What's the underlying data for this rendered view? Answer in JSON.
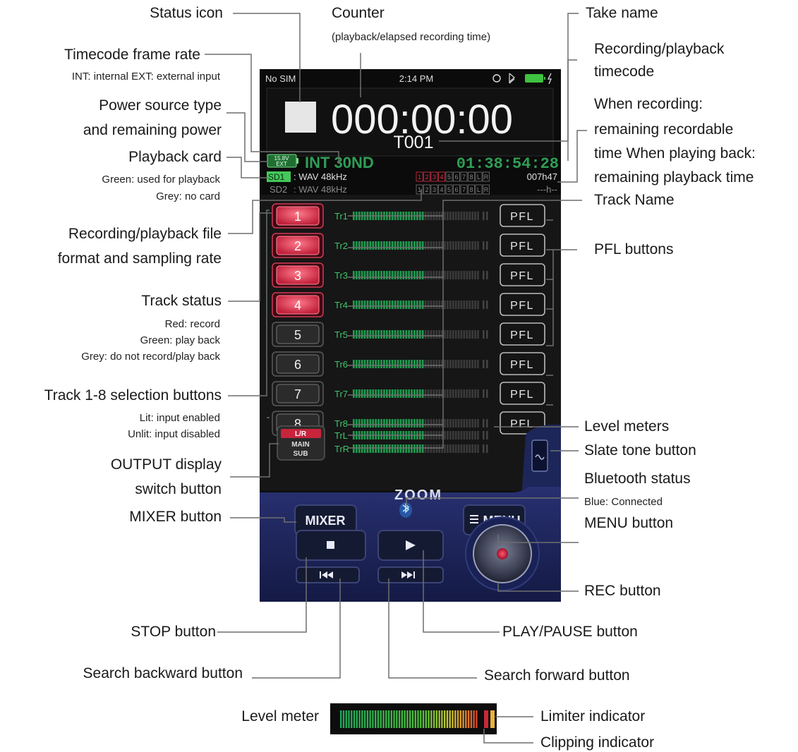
{
  "annotations": {
    "status_icon": "Status icon",
    "counter": "Counter",
    "counter_sub": "(playback/elapsed recording time)",
    "take_name": "Take name",
    "timecode_frame_rate": "Timecode frame rate",
    "timecode_frame_rate_sub": "INT: internal EXT: external input",
    "rec_play_timecode_1": "Recording/playback",
    "rec_play_timecode_2": "timecode",
    "power_source_1": "Power source type",
    "power_source_2": "and remaining power",
    "remaining_1": "When recording:",
    "remaining_2": "remaining recordable",
    "remaining_3": "time When playing back:",
    "remaining_4": "remaining playback time",
    "playback_card": "Playback card",
    "playback_card_green": "Green: used for playback",
    "playback_card_grey": "Grey: no card",
    "track_name": "Track Name",
    "file_format_1": "Recording/playback file",
    "file_format_2": "format and sampling rate",
    "pfl_buttons": "PFL buttons",
    "track_status": "Track status",
    "track_status_red": "Red: record",
    "track_status_green": "Green: play back",
    "track_status_grey": "Grey: do not record/play back",
    "track_selection": "Track 1-8 selection buttons",
    "track_selection_lit": "Lit: input enabled",
    "track_selection_unlit": "Unlit: input disabled",
    "level_meters": "Level meters",
    "slate_tone": "Slate tone button",
    "output_display_1": "OUTPUT display",
    "output_display_2": "switch button",
    "bluetooth_status": "Bluetooth status",
    "bluetooth_sub": "Blue: Connected",
    "mixer_button": "MIXER button",
    "menu_button": "MENU button",
    "rec_button": "REC button",
    "stop_button": "STOP button",
    "play_pause_button": "PLAY/PAUSE button",
    "search_backward": "Search backward button",
    "search_forward": "Search forward button",
    "level_meter": "Level meter",
    "limiter_indicator": "Limiter indicator",
    "clipping_indicator": "Clipping indicator"
  },
  "screen": {
    "status_bar": {
      "carrier": "No SIM",
      "time": "2:14 PM"
    },
    "counter": "000:00:00",
    "take_name": "T001",
    "power_badge_top": "15.8V",
    "power_badge_bottom": "EXT",
    "frame_rate": "INT 30ND",
    "timecode": "01:38:54:28",
    "cards": [
      {
        "label": "SD1",
        "format": ": WAV 48kHz",
        "remaining": "007h47",
        "active": true
      },
      {
        "label": "SD2",
        "format": ": WAV 48kHz",
        "remaining": "---h--",
        "active": false
      }
    ],
    "track_indicator_labels": [
      "1",
      "2",
      "3",
      "4",
      "5",
      "6",
      "7",
      "8",
      "L",
      "R"
    ],
    "tracks": [
      {
        "number": "1",
        "name": "Tr1",
        "armed": true
      },
      {
        "number": "2",
        "name": "Tr2",
        "armed": true
      },
      {
        "number": "3",
        "name": "Tr3",
        "armed": true
      },
      {
        "number": "4",
        "name": "Tr4",
        "armed": true
      },
      {
        "number": "5",
        "name": "Tr5",
        "armed": false
      },
      {
        "number": "6",
        "name": "Tr6",
        "armed": false
      },
      {
        "number": "7",
        "name": "Tr7",
        "armed": false
      },
      {
        "number": "8",
        "name": "Tr8",
        "armed": false
      }
    ],
    "pfl_label": "PFL",
    "output_lines": [
      "L/R",
      "MAIN",
      "SUB"
    ],
    "main_meters": [
      "TrL",
      "TrR"
    ],
    "brand": "ZOOM",
    "mixer_label": "MIXER",
    "menu_label": "MENU"
  },
  "colors": {
    "record_red": "#e0334a",
    "playback_green": "#2f9e55",
    "bluetooth_blue": "#3fa9ff",
    "panel_navy": "#1b2150"
  }
}
